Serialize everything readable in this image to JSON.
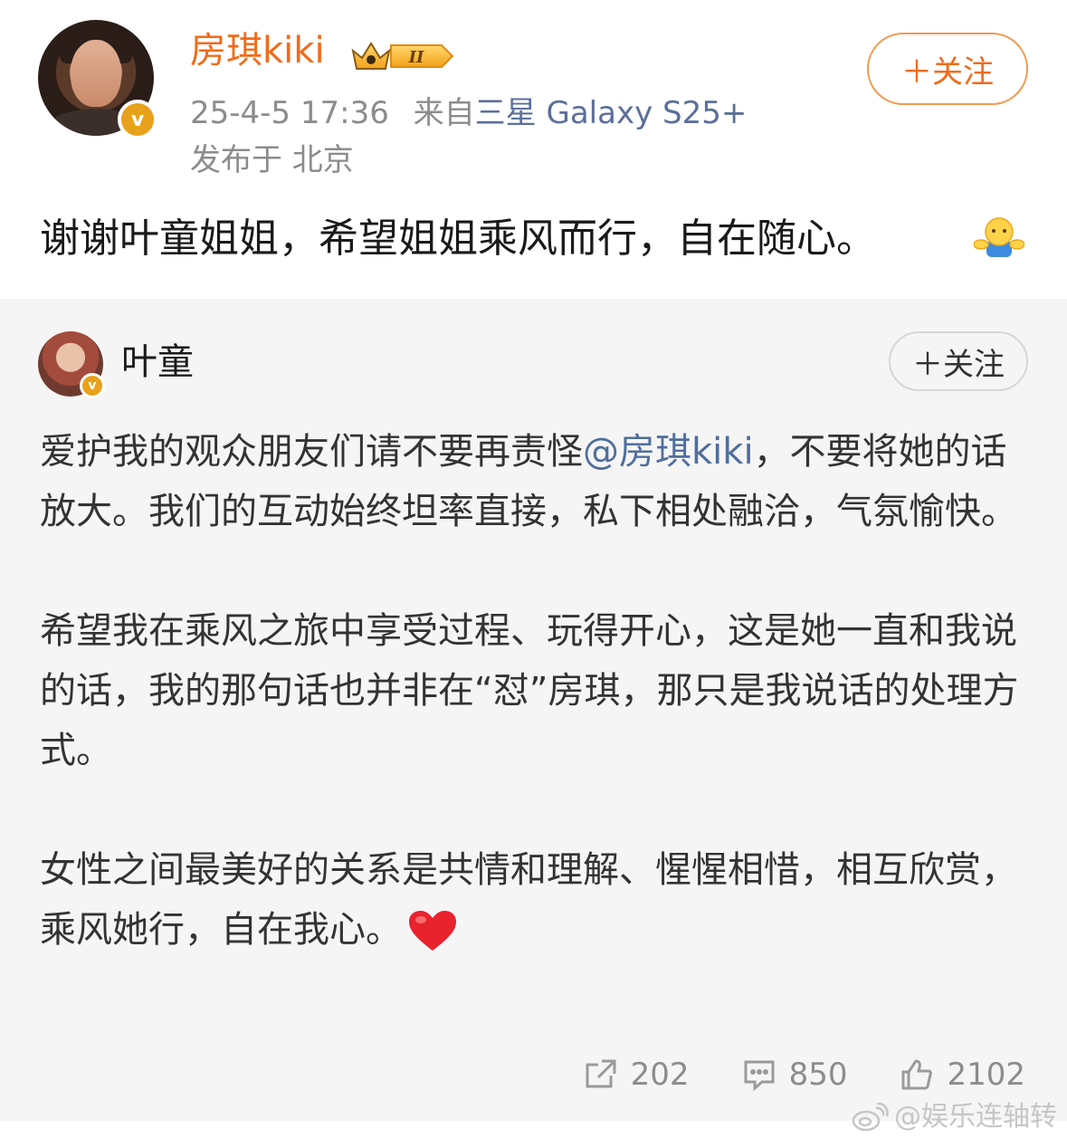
{
  "post": {
    "username": "房琪kiki",
    "level_badge": "II",
    "timestamp": "25-4-5 17:36",
    "source_prefix": "来自",
    "device": "三星 Galaxy S25+",
    "location": "发布于 北京",
    "follow_label": "＋关注",
    "text": "谢谢叶童姐姐，希望姐姐乘风而行，自在随心。",
    "emoji": "hug-emoji"
  },
  "repost": {
    "username": "叶童",
    "follow_label": "＋关注",
    "p1_before_mention": "爱护我的观众朋友们请不要再责怪",
    "mention": "@房琪kiki",
    "p1_after_mention": "，不要将她的话放大。我们的互动始终坦率直接，私下相处融洽，气氛愉快。",
    "p2": "希望我在乘风之旅中享受过程、玩得开心，这是她一直和我说的话，我的那句话也并非在“怼”房琪，那只是我说话的处理方式。",
    "p3": "女性之间最美好的关系是共情和理解、惺惺相惜，相互欣赏，乘风她行，自在我心。",
    "heart": "heart-emoji"
  },
  "actions": {
    "reposts": "202",
    "comments": "850",
    "likes": "2102"
  },
  "watermark": "@娱乐连轴转",
  "colors": {
    "username_orange": "#f26a1a",
    "link_blue": "#4f6e9c",
    "meta_gray": "#8c8c8c",
    "repost_bg": "#f5f5f5",
    "verified_gold": "#e8a11a"
  }
}
